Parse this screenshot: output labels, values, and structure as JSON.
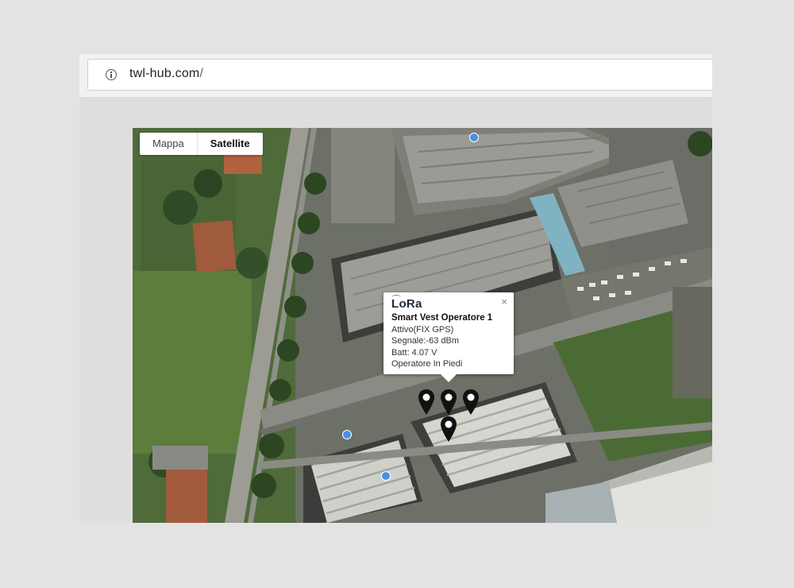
{
  "browser": {
    "url_main": "twl-hub.com",
    "url_rest": "/"
  },
  "map": {
    "map_types": [
      {
        "label": "Mappa",
        "selected": false
      },
      {
        "label": "Satellite",
        "selected": true
      }
    ],
    "popup": {
      "logo_text": "LoRa",
      "title": "Smart Vest Operatore 1",
      "lines": [
        "Attivo(FIX GPS)",
        "Segnale:-63 dBm",
        "Batt: 4.07 V",
        "Operatore In Piedi"
      ],
      "close_glyph": "×"
    },
    "markers": [
      {
        "name": "marker-1"
      },
      {
        "name": "marker-2"
      },
      {
        "name": "marker-3"
      },
      {
        "name": "marker-4"
      }
    ]
  },
  "colors": {
    "popup_logo": "#1f2b3a",
    "logo_wave": "#2b8fd6",
    "marker": "#111111",
    "poi": "#4a8fe0"
  }
}
